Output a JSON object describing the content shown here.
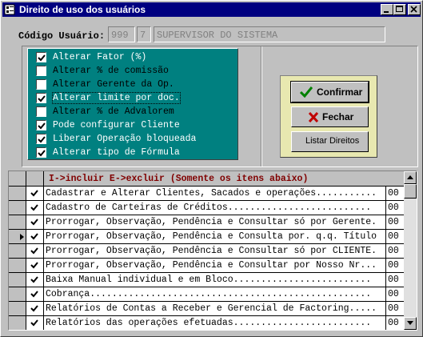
{
  "window": {
    "title": "Direito de uso dos usuários",
    "controls": [
      "minimize-icon",
      "maximize-icon",
      "close-icon"
    ]
  },
  "user": {
    "label": "Código Usuário:",
    "field1": "999",
    "field2": "7",
    "name": "SUPERVISOR DO SISTEMA"
  },
  "permissions": [
    {
      "label": "Alterar Fator (%)",
      "checked": true
    },
    {
      "label": "Alterar % de comissão",
      "checked": false
    },
    {
      "label": "Alterar Gerente da Op.",
      "checked": false
    },
    {
      "label": "Alterar limite por doc.",
      "checked": true
    },
    {
      "label": "Alterar % de Advalorem",
      "checked": false
    },
    {
      "label": "Pode configurar Cliente",
      "checked": true
    },
    {
      "label": "Liberar Operação bloqueada",
      "checked": true
    },
    {
      "label": "Alterar tipo de Fórmula",
      "checked": true
    }
  ],
  "buttons": {
    "confirm": "Confirmar",
    "close": "Fechar",
    "list": "Listar Direitos"
  },
  "grid": {
    "header": "I->incluir   E->excluir (Somente os itens abaixo)",
    "rows": [
      {
        "desc": "Cadastrar e Alterar Clientes, Sacados e operações...........",
        "code": "00",
        "checked": true
      },
      {
        "desc": "Cadastro de Carteiras de Créditos..........................",
        "code": "00",
        "checked": true
      },
      {
        "desc": "Prorrogar, Observação, Pendência e Consultar só por Gerente.",
        "code": "00",
        "checked": true
      },
      {
        "desc": "Prorrogar, Observação, Pendência e Consulta por. q.q. Título",
        "code": "00",
        "checked": true
      },
      {
        "desc": "Prorrogar, Observação, Pendência e Consultar só por CLIENTE.",
        "code": "00",
        "checked": true
      },
      {
        "desc": "Prorrogar, Observação, Pendência e Consultar por Nosso Nr...",
        "code": "00",
        "checked": true
      },
      {
        "desc": "Baixa Manual individual e em Bloco.........................",
        "code": "00",
        "checked": true
      },
      {
        "desc": "Cobrança...................................................",
        "code": "00",
        "checked": true
      },
      {
        "desc": "Relatórios de Contas a Receber e Gerencial de Factoring.....",
        "code": "00",
        "checked": true
      },
      {
        "desc": "Relatórios das operações efetuadas.........................",
        "code": "00",
        "checked": true
      }
    ],
    "current_row": 3
  }
}
